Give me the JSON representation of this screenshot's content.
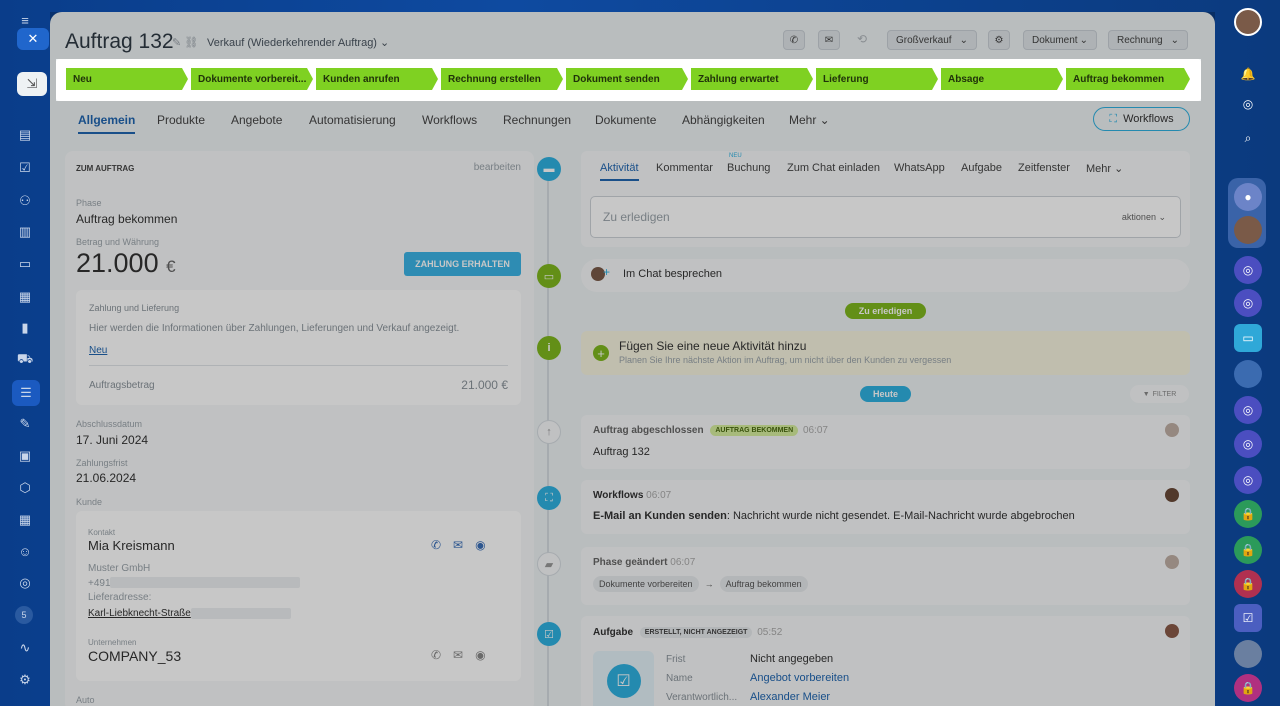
{
  "left_nav": {
    "icons": [
      "close-icon",
      "grid-icon",
      "feed-icon",
      "tasks-icon",
      "people-icon",
      "docs-icon",
      "card-icon",
      "chart-icon",
      "analytics-icon",
      "cart-icon",
      "filter-icon",
      "list-icon",
      "inbox-icon",
      "box-icon",
      "calendar-icon",
      "bot-icon",
      "bucket-icon",
      "counter-icon",
      "wave-icon",
      "settings-icon"
    ],
    "counter": "5"
  },
  "header": {
    "title": "Auftrag 132",
    "subtitle": "Verkauf (Wiederkehrender Auftrag)",
    "price_list": "Großverkauf",
    "document": "Dokument",
    "invoice": "Rechnung"
  },
  "stages": [
    "Neu",
    "Dokumente vorbereit...",
    "Kunden anrufen",
    "Rechnung erstellen",
    "Dokument senden",
    "Zahlung erwartet",
    "Lieferung",
    "Absage",
    "Auftrag bekommen"
  ],
  "tabs": {
    "items": [
      "Allgemein",
      "Produkte",
      "Angebote",
      "Automatisierung",
      "Workflows",
      "Rechnungen",
      "Dokumente",
      "Abhängigkeiten",
      "Mehr"
    ],
    "workflows_btn": "Workflows"
  },
  "left": {
    "section_title": "ZUM AUFTRAG",
    "edit": "bearbeiten",
    "phase_label": "Phase",
    "phase_value": "Auftrag bekommen",
    "amount_label": "Betrag und Währung",
    "amount": "21.000",
    "currency": "€",
    "pay_btn": "ZAHLUNG ERHALTEN",
    "payment_title": "Zahlung und Lieferung",
    "payment_info": "Hier werden die Informationen über Zahlungen, Lieferungen und Verkauf angezeigt.",
    "new_link": "Neu",
    "order_amount_label": "Auftragsbetrag",
    "order_amount": "21.000 €",
    "close_date_label": "Abschlussdatum",
    "close_date": "17. Juni 2024",
    "due_label": "Zahlungsfrist",
    "due": "21.06.2024",
    "client_label": "Kunde",
    "contact_label": "Kontakt",
    "contact_name": "Mia Kreismann",
    "company_line": "Muster GmbH",
    "phone": "+491",
    "address_label": "Lieferadresse:",
    "address": "Karl-Liebknecht-Straße",
    "company_label": "Unternehmen",
    "company": "COMPANY_53",
    "auto_label": "Auto"
  },
  "activity": {
    "tabs": [
      "Aktivität",
      "Kommentar",
      "Buchung",
      "Zum Chat einladen",
      "WhatsApp",
      "Aufgabe",
      "Zeitfenster",
      "Mehr"
    ],
    "new_tag": "NEU",
    "todo_placeholder": "Zu erledigen",
    "actions": "aktionen",
    "chat": "Im Chat besprechen",
    "todo_pill": "Zu erledigen",
    "add_title": "Fügen Sie eine neue Aktivität hinzu",
    "add_desc": "Planen Sie Ihre nächste Aktion im Auftrag, um nicht über den Kunden zu vergessen",
    "today_pill": "Heute",
    "filter": "FILTER",
    "e1_title": "Auftrag abgeschlossen",
    "e1_badge": "AUFTRAG BEKOMMEN",
    "e1_time": "06:07",
    "e1_text": "Auftrag 132",
    "e2_title": "Workflows",
    "e2_time": "06:07",
    "e2_bold": "E-Mail an Kunden senden",
    "e2_text": ": Nachricht wurde nicht gesendet. E-Mail-Nachricht wurde abgebrochen",
    "e3_title": "Phase geändert",
    "e3_time": "06:07",
    "e3_from": "Dokumente vorbereiten",
    "e3_to": "Auftrag bekommen",
    "e4_title": "Aufgabe",
    "e4_badge": "ERSTELLT, NICHT ANGEZEIGT",
    "e4_time": "05:52",
    "e4_frist_label": "Frist",
    "e4_frist": "Nicht angegeben",
    "e4_name_label": "Name",
    "e4_name": "Angebot vorbereiten",
    "e4_resp_label": "Verantwortlich...",
    "e4_resp": "Alexander Meier"
  },
  "colors": {
    "stage": "#7fd122",
    "accent": "#2fb1e0",
    "overlay": "rgba(0,0,0,0.22)"
  }
}
